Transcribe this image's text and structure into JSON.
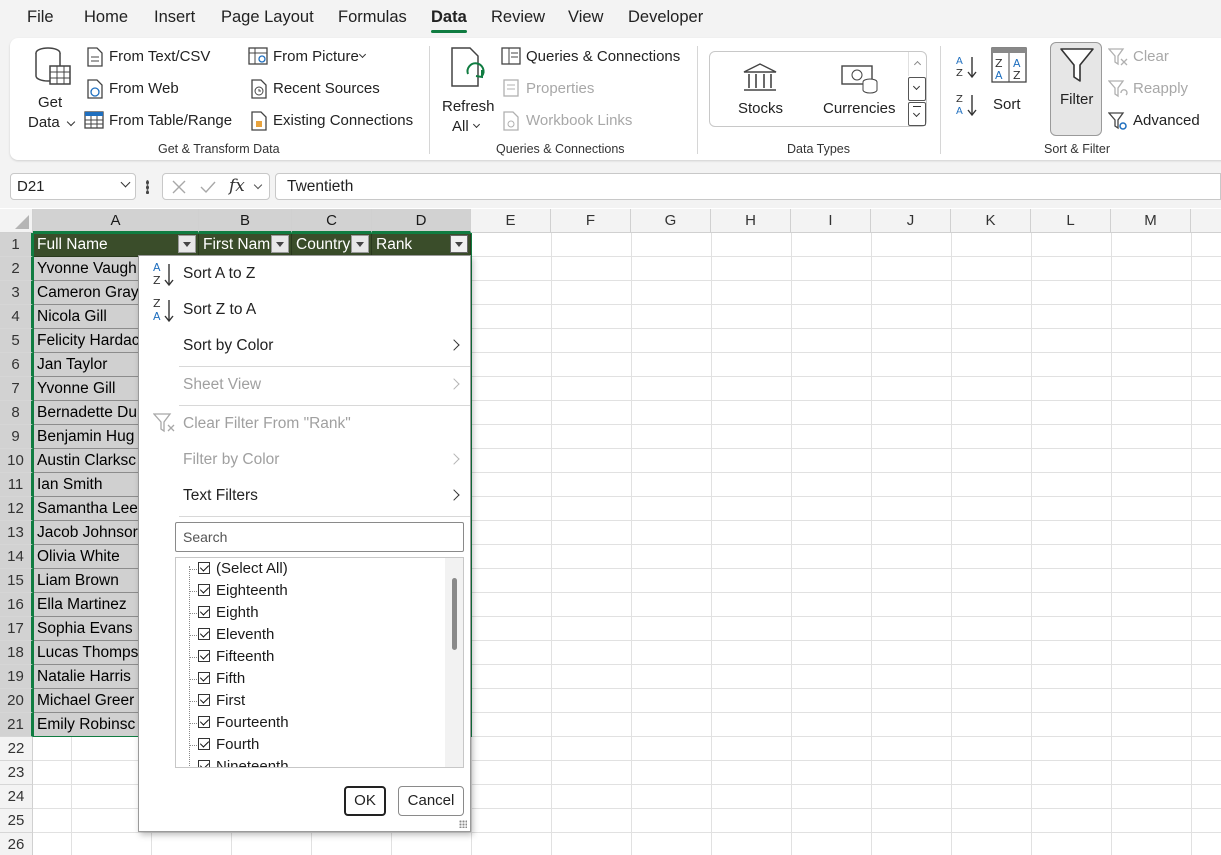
{
  "menu_tabs": [
    "File",
    "Home",
    "Insert",
    "Page Layout",
    "Formulas",
    "Data",
    "Review",
    "View",
    "Developer"
  ],
  "active_tab": "Data",
  "ribbon": {
    "get_data": {
      "line1": "Get",
      "line2": "Data"
    },
    "get_transform": {
      "from_text_csv": "From Text/CSV",
      "from_web": "From Web",
      "from_table_range": "From Table/Range",
      "from_picture": "From Picture",
      "recent_sources": "Recent Sources",
      "existing_connections": "Existing Connections",
      "group_label": "Get & Transform Data"
    },
    "queries": {
      "refresh_line1": "Refresh",
      "refresh_line2": "All",
      "queries_connections": "Queries & Connections",
      "properties": "Properties",
      "workbook_links": "Workbook Links",
      "group_label": "Queries & Connections"
    },
    "data_types": {
      "stocks": "Stocks",
      "currencies": "Currencies",
      "group_label": "Data Types"
    },
    "sort_filter": {
      "sort": "Sort",
      "filter": "Filter",
      "clear": "Clear",
      "reapply": "Reapply",
      "advanced": "Advanced",
      "group_label": "Sort & Filter"
    }
  },
  "formula_bar": {
    "name_box": "D21",
    "fx": "fx",
    "formula": "Twentieth"
  },
  "columns": [
    "A",
    "B",
    "C",
    "D",
    "E",
    "F",
    "G",
    "H",
    "I",
    "J",
    "K",
    "L",
    "M"
  ],
  "row_numbers": [
    "1",
    "2",
    "3",
    "4",
    "5",
    "6",
    "7",
    "8",
    "9",
    "10",
    "11",
    "12",
    "13",
    "14",
    "15",
    "16",
    "17",
    "18",
    "19",
    "20",
    "21",
    "22",
    "23",
    "24",
    "25",
    "26"
  ],
  "header_row": [
    "Full Name",
    "First Nam",
    "Country",
    "Rank"
  ],
  "names": [
    "Yvonne Vaugh",
    "Cameron Gray",
    "Nicola Gill",
    "Felicity Hardac",
    "Jan Taylor",
    "Yvonne Gill",
    "Bernadette Du",
    "Benjamin Hug",
    "Austin Clarksc",
    "Ian Smith",
    "Samantha Lee",
    "Jacob Johnsor",
    "Olivia White",
    "Liam Brown",
    "Ella Martinez",
    "Sophia Evans",
    "Lucas Thomps",
    "Natalie Harris",
    "Michael Greer",
    "Emily Robinsc"
  ],
  "filter_menu": {
    "sort_az": "Sort A to Z",
    "sort_za": "Sort Z to A",
    "sort_by_color": "Sort by Color",
    "sheet_view": "Sheet View",
    "clear_filter": "Clear Filter From \"Rank\"",
    "filter_by_color": "Filter by Color",
    "text_filters": "Text Filters",
    "search_placeholder": "Search",
    "list_items": [
      "(Select All)",
      "Eighteenth",
      "Eighth",
      "Eleventh",
      "Fifteenth",
      "Fifth",
      "First",
      "Fourteenth",
      "Fourth",
      "Nineteenth"
    ],
    "ok": "OK",
    "cancel": "Cancel"
  },
  "colors": {
    "accent": "#107c41",
    "header_fill": "#3a4d2a",
    "selection_fill": "#d0d0d0"
  }
}
